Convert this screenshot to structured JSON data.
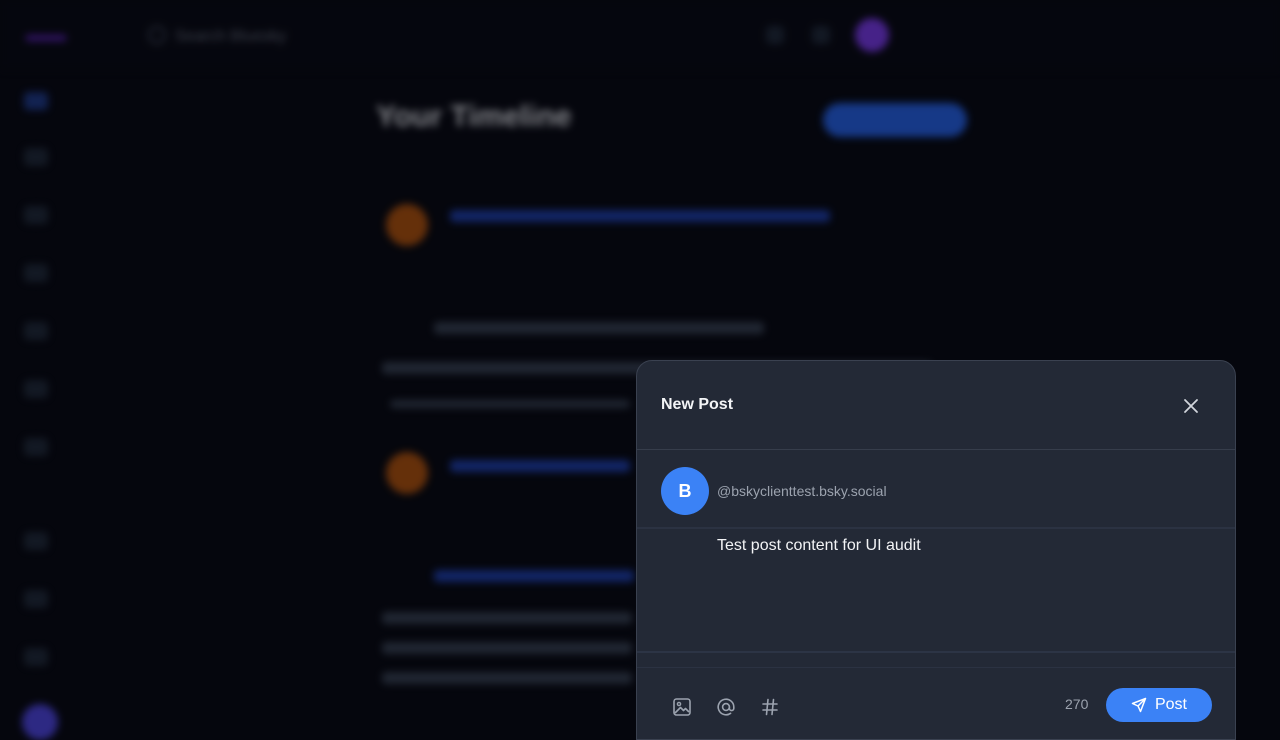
{
  "background": {
    "timeline_title": "Your Timeline",
    "top_handle_placeholder": "",
    "search_placeholder": "Search Bluesky"
  },
  "modal": {
    "title": "New Post",
    "author": {
      "avatar_initial": "B",
      "handle": "@bskyclienttest.bsky.social"
    },
    "composer": {
      "text": "Test post content for UI audit"
    },
    "footer": {
      "char_remaining": "270",
      "post_label": "Post",
      "tools": [
        "image-icon",
        "mention-icon",
        "hashtag-icon"
      ]
    }
  },
  "colors": {
    "accent": "#3b82f6",
    "modal_bg": "#232936",
    "page_bg": "#05060d"
  }
}
